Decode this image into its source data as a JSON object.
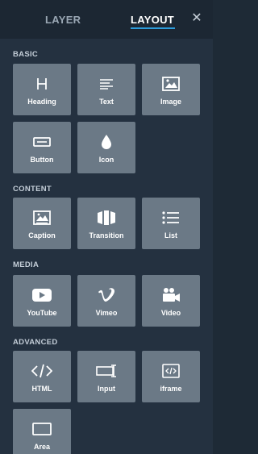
{
  "tabs": {
    "layer": "LAYER",
    "layout": "LAYOUT",
    "close_icon": "close-icon"
  },
  "sections": {
    "basic": {
      "title": "BASIC",
      "items": [
        {
          "label": "Heading",
          "icon": "heading-icon"
        },
        {
          "label": "Text",
          "icon": "text-icon"
        },
        {
          "label": "Image",
          "icon": "image-icon"
        },
        {
          "label": "Button",
          "icon": "button-icon"
        },
        {
          "label": "Icon",
          "icon": "droplet-icon"
        }
      ]
    },
    "content": {
      "title": "CONTENT",
      "items": [
        {
          "label": "Caption",
          "icon": "caption-icon"
        },
        {
          "label": "Transition",
          "icon": "transition-icon"
        },
        {
          "label": "List",
          "icon": "list-icon"
        }
      ]
    },
    "media": {
      "title": "MEDIA",
      "items": [
        {
          "label": "YouTube",
          "icon": "youtube-icon"
        },
        {
          "label": "Vimeo",
          "icon": "vimeo-icon"
        },
        {
          "label": "Video",
          "icon": "video-icon"
        }
      ]
    },
    "advanced": {
      "title": "ADVANCED",
      "items": [
        {
          "label": "HTML",
          "icon": "code-icon"
        },
        {
          "label": "Input",
          "icon": "input-icon"
        },
        {
          "label": "iframe",
          "icon": "iframe-icon"
        },
        {
          "label": "Area",
          "icon": "area-icon"
        }
      ]
    }
  },
  "colors": {
    "panel": "#243140",
    "tile": "#6b7986",
    "accent": "#2d9cdb"
  }
}
